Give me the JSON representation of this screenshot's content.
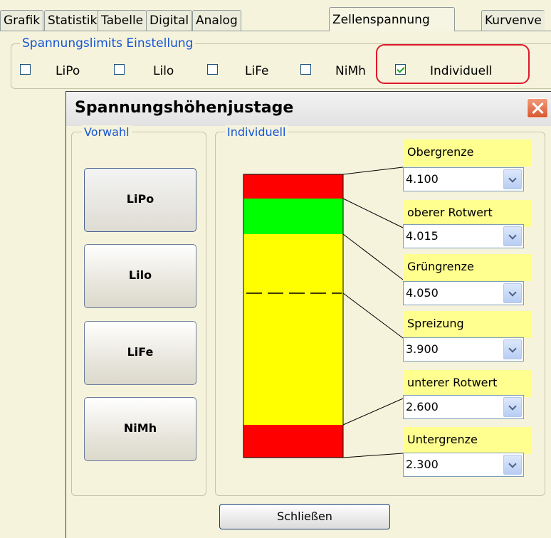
{
  "tabs": [
    "Grafik",
    "Statistik",
    "Tabelle",
    "Digital",
    "Analog",
    "Zellenspannung",
    "Kurvenve"
  ],
  "active_tab": "Zellenspannung",
  "limits_group": {
    "legend": "Spannungslimits Einstellung",
    "options": [
      {
        "label": "LiPo",
        "checked": false
      },
      {
        "label": "Lilo",
        "checked": false
      },
      {
        "label": "LiFe",
        "checked": false
      },
      {
        "label": "NiMh",
        "checked": false
      },
      {
        "label": "Individuell",
        "checked": true
      }
    ]
  },
  "dialog": {
    "title": "Spannungshöhenjustage",
    "preset_group": {
      "legend": "Vorwahl",
      "buttons": [
        "LiPo",
        "Lilo",
        "LiFe",
        "NiMh"
      ]
    },
    "custom_group": {
      "legend": "Individuell",
      "fields": [
        {
          "label": "Obergrenze",
          "value": "4.100"
        },
        {
          "label": "oberer Rotwert",
          "value": "4.015"
        },
        {
          "label": "Grüngrenze",
          "value": "4.050"
        },
        {
          "label": "Spreizung",
          "value": "3.900"
        },
        {
          "label": "unterer Rotwert",
          "value": "2.600"
        },
        {
          "label": "Untergrenze",
          "value": "2.300"
        }
      ]
    },
    "close_button": "Schließen"
  },
  "colors": {
    "red": "#ff0000",
    "green": "#00ff00",
    "yellow": "#ffff00",
    "label_bg": "#ffff90",
    "highlight": "#e0182a",
    "legend_text": "#1554d6"
  }
}
